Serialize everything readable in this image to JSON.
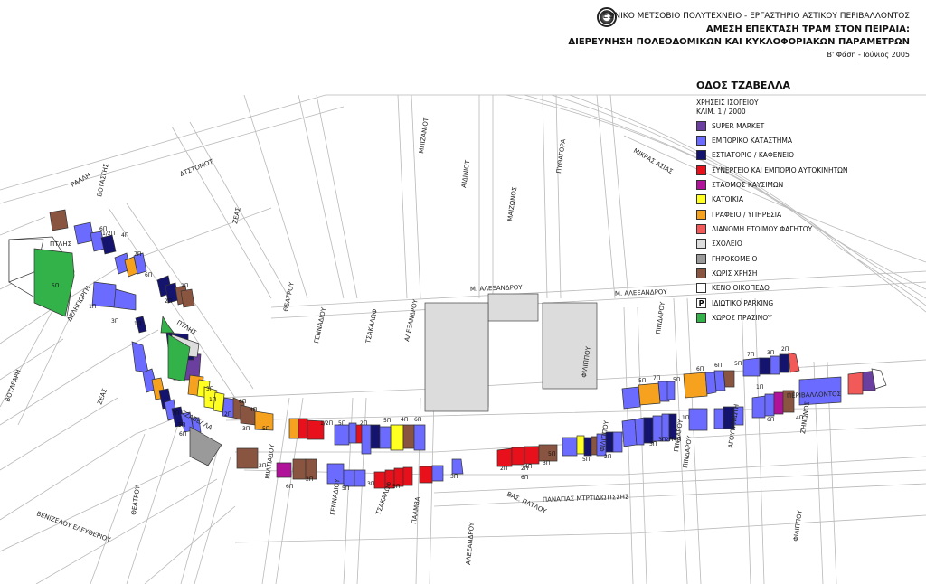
{
  "header": {
    "institution": "ΕΘΝΙΚΟ ΜΕΤΣΟΒΙΟ ΠΟΛΥΤΕΧΝΕΙΟ -  ΕΡΓΑΣΤΗΡΙΟ ΑΣΤΙΚΟΥ ΠΕΡΙΒΑΛΛΟΝΤΟΣ",
    "title_line1": "ΑΜΕΣΗ ΕΠΕΚΤΑΣΗ ΤΡΑΜ ΣΤΟΝ ΠΕΙΡΑΙΑ:",
    "title_line2": "ΔΙΕΡΕΥΝΗΣΗ ΠΟΛΕΟΔΟΜΙΚΩΝ ΚΑΙ ΚΥΚΛΟΦΟΡΙΑΚΩΝ ΠΑΡΑΜΕΤΡΩΝ",
    "phase": "Β' Φάση - Ιούνιος 2005"
  },
  "legend": {
    "title": "ΟΔΟΣ ΤΖΑΒΕΛΛΑ",
    "subtitle1": "ΧΡΗΣΕΙΣ ΙΣΟΓΕΙΟΥ",
    "subtitle2": "ΚΛΙΜ. 1 / 2000",
    "items": [
      {
        "label": "SUPER MARKET",
        "color": "#6a3fa0"
      },
      {
        "label": "ΕΜΠΟΡΙΚΟ ΚΑΤΑΣΤΗΜΑ",
        "color": "#6b6bff"
      },
      {
        "label": "ΕΣΤΙΑΤΟΡΙΟ / ΚΑΦΕΝΕΙΟ",
        "color": "#14146e"
      },
      {
        "label": "ΣΥΝΕΡΓΕΙΟ ΚΑΙ ΕΜΠΟΡΙΟ ΑΥΤΟΚΙΝΗΤΩΝ",
        "color": "#e8101a"
      },
      {
        "label": "ΣΤΑΘΜΟΣ ΚΑΥΣΙΜΩΝ",
        "color": "#b0129a"
      },
      {
        "label": "ΚΑΤΟΙΚΙΑ",
        "color": "#ffff22"
      },
      {
        "label": "ΓΡΑΦΕΙΟ / ΥΠΗΡΕΣΙΑ",
        "color": "#f7a21f"
      },
      {
        "label": "ΔΙΑΝΟΜΗ ΕΤΟΙΜΟΥ ΦΑΓΗΤΟΥ",
        "color": "#f25a5a"
      },
      {
        "label": "ΣΧΟΛΕΙΟ",
        "color": "#dddddd"
      },
      {
        "label": "ΓΗΡΟΚΟΜΕΙΟ",
        "color": "#9a9a9a"
      },
      {
        "label": "ΧΩΡΙΣ ΧΡΗΣΗ",
        "color": "#8a5540"
      },
      {
        "label": "ΚΕΝΟ ΟΙΚΟΠΕΔΟ",
        "color": "#ffffff"
      },
      {
        "label": "ΙΔΙΩΤΙΚΟ PARKING",
        "color": "#ffffff",
        "mark": "P"
      },
      {
        "label": "ΧΩΡΟΣ ΠΡΑΣΙΝΟΥ",
        "color": "#33b24a"
      }
    ]
  },
  "streets": [
    {
      "name": "ΡΑΛΛΗ"
    },
    {
      "name": "ΒΟΤΑΣΓΗΣ"
    },
    {
      "name": "ΔΤΣΤΟΜΟΤ"
    },
    {
      "name": "ΖΕΑΣ"
    },
    {
      "name": "ΜΠΙΖΑΝΙΟΤ"
    },
    {
      "name": "ΑΙΔΙΝΙΟΤ"
    },
    {
      "name": "ΜΑΙΖΩΝΟΣ"
    },
    {
      "name": "ΠΥΘΑΓΟΡΑ"
    },
    {
      "name": "ΜΙΚΡΑΣ ΑΣΙΑΣ"
    },
    {
      "name": "Μ. ΑΛΕΞΑΝΔΡΟΥ"
    },
    {
      "name": "Μ. ΑΛΕΞΑΝΔΡΟΥ"
    },
    {
      "name": "ΠΤΛΗΣ"
    },
    {
      "name": "ΠΤΛΗΣ"
    },
    {
      "name": "ΘΕΑΤΡΟΥ"
    },
    {
      "name": "ΓΕΝΝΑΔΙΟΥ"
    },
    {
      "name": "ΤΣΑΚΑΛΩΦ"
    },
    {
      "name": "ΑΛΕΞΑΝΔΡΟΥ"
    },
    {
      "name": "ΦΙΛΙΠΠΟΥ"
    },
    {
      "name": "ΠΙΝΔΑΡΟΥ"
    },
    {
      "name": "ΔΕΛΗΓΙΩΡΓΗ"
    },
    {
      "name": "ΒΟΤΛΓΑΡΗ"
    },
    {
      "name": "ΤΖΑΒΕΛΛΑ"
    },
    {
      "name": "ΜΙΛΤΙΑΔΟΥ"
    },
    {
      "name": "ΓΕΝΝΑΔΙΟΥ"
    },
    {
      "name": "ΤΣΑΚΑΛΩΦ"
    },
    {
      "name": "ΠΑΛΜΒΑ"
    },
    {
      "name": "ΑΛΕΞΑΝΔΡΟΥ"
    },
    {
      "name": "ΒΑΣ. ΠΑΤΛΟΥ"
    },
    {
      "name": "ΠΑΝΑΓΙΑΣ ΜΤΡΤΙΔΙΩΤΙΣΣΗΣ"
    },
    {
      "name": "ΦΙΛΙΠΠΟΥ"
    },
    {
      "name": "ΠΙΝΔΑΡΟΥ"
    },
    {
      "name": "ΑΓΟΥΤΡΝΙΩΤΗ"
    },
    {
      "name": "ΠΙΝΔΑΡΟΥ"
    },
    {
      "name": "ΠΕΡΙΒΑΛΛΟΝΤΟΣ"
    },
    {
      "name": "ΖΕΑΣ"
    },
    {
      "name": "ΘΕΑΤΡΟΥ"
    },
    {
      "name": "ΒΕΝΙΖΕΛΟΥ ΕΛΕΥΘΕΡΙΟΥ"
    },
    {
      "name": "ΦΙΛΙΠΠΟΥ"
    },
    {
      "name": "ΖΗΝΩΝΟΣ"
    }
  ],
  "storey_labels": [
    "5Π",
    "7Π",
    "3Π",
    "1Π",
    "2Π",
    "1/2Π",
    "6Π",
    "6Π",
    "2Π",
    "4Π",
    "1Π",
    "6Π",
    "5Π",
    "7Π",
    "1Π",
    "3Π",
    "6Π",
    "2Π",
    "4Π",
    "3Π",
    "5Π",
    "2Π",
    "2Π",
    "6Π",
    "1/2Π",
    "5Π",
    "2Π",
    "5Π",
    "3Π",
    "5Π",
    "4Π",
    "6Π",
    "5Π",
    "3Π",
    "2Π",
    "2Π",
    "6Π",
    "4Π",
    "3Π",
    "5Π",
    "5Π",
    "2Π",
    "3Π",
    "3Π",
    "2Π",
    "4Π",
    "1Π",
    "5Π",
    "7Π",
    "5Π",
    "6Π",
    "6Π",
    "5Π",
    "7Π",
    "3Π",
    "2Π",
    "1Π",
    "6Π",
    "4Π"
  ],
  "parcels": [
    {
      "use": 10
    },
    {
      "use": 1
    },
    {
      "use": 1
    },
    {
      "use": 2
    },
    {
      "use": 1
    },
    {
      "use": 1
    },
    {
      "use": 6
    },
    {
      "use": 1
    },
    {
      "use": 1
    },
    {
      "use": 2
    },
    {
      "use": 2
    },
    {
      "use": 10
    },
    {
      "use": 10
    },
    {
      "use": 1
    },
    {
      "use": 2
    },
    {
      "use": 2
    },
    {
      "use": 0
    },
    {
      "use": 2
    },
    {
      "use": 6
    },
    {
      "use": 5
    },
    {
      "use": 1
    },
    {
      "use": 6
    },
    {
      "use": 2
    },
    {
      "use": 1
    },
    {
      "use": 2
    },
    {
      "use": 1
    },
    {
      "use": 1
    },
    {
      "use": 5
    },
    {
      "use": 5
    },
    {
      "use": 1
    },
    {
      "use": 10
    },
    {
      "use": 10
    },
    {
      "use": 6
    },
    {
      "use": 6
    },
    {
      "use": 3
    },
    {
      "use": 3
    },
    {
      "use": 1
    },
    {
      "use": 1
    },
    {
      "use": 3
    },
    {
      "use": 1
    },
    {
      "use": 2
    },
    {
      "use": 5
    },
    {
      "use": 10
    },
    {
      "use": 1
    },
    {
      "use": 1
    },
    {
      "use": 10
    },
    {
      "use": 4
    },
    {
      "use": 10
    },
    {
      "use": 10
    },
    {
      "use": 1
    },
    {
      "use": 1
    },
    {
      "use": 1
    },
    {
      "use": 3
    },
    {
      "use": 3
    },
    {
      "use": 3
    },
    {
      "use": 3
    },
    {
      "use": 3
    },
    {
      "use": 1
    },
    {
      "use": 1
    },
    {
      "use": 3
    },
    {
      "use": 3
    },
    {
      "use": 3
    },
    {
      "use": 10
    },
    {
      "use": 1
    },
    {
      "use": 5
    },
    {
      "use": 2
    },
    {
      "use": 10
    },
    {
      "use": 1
    },
    {
      "use": 2
    },
    {
      "use": 1
    },
    {
      "use": 1
    },
    {
      "use": 6
    },
    {
      "use": 1
    },
    {
      "use": 1
    },
    {
      "use": 6
    },
    {
      "use": 1
    },
    {
      "use": 1
    },
    {
      "use": 10
    },
    {
      "use": 1
    },
    {
      "use": 2
    },
    {
      "use": 1
    },
    {
      "use": 2
    },
    {
      "use": 7
    },
    {
      "use": 1
    },
    {
      "use": 1
    },
    {
      "use": 2
    },
    {
      "use": 1
    },
    {
      "use": 1
    },
    {
      "use": 2
    },
    {
      "use": 1
    },
    {
      "use": 1
    },
    {
      "use": 2
    },
    {
      "use": 1
    },
    {
      "use": 1
    },
    {
      "use": 1
    },
    {
      "use": 4
    },
    {
      "use": 10
    },
    {
      "use": 1
    },
    {
      "use": 7
    },
    {
      "use": 0
    },
    {
      "use": 11
    },
    {
      "use": 11
    },
    {
      "use": 11
    },
    {
      "use": 8
    },
    {
      "use": 9
    },
    {
      "use": 13
    },
    {
      "use": 13
    },
    {
      "use": 13
    }
  ]
}
